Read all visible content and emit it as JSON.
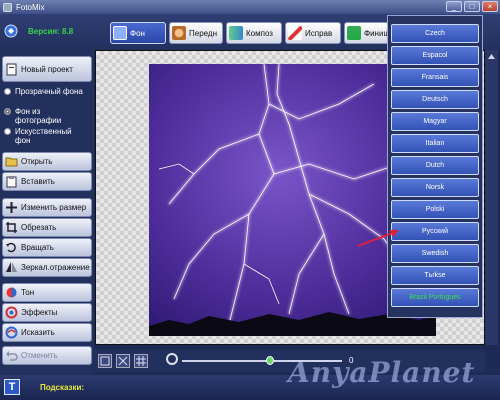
{
  "window": {
    "title": "FotoMix"
  },
  "header": {
    "version": "Версия: 8.8"
  },
  "tabs": [
    {
      "label": "Фон"
    },
    {
      "label": "Передн"
    },
    {
      "label": "Композ"
    },
    {
      "label": "Исправ"
    },
    {
      "label": "Финиш"
    }
  ],
  "sidebar": {
    "new_project": "Новый проект",
    "background_options": [
      {
        "label": "Прозрачный фона"
      },
      {
        "label": "Фон из фотографии"
      },
      {
        "label": "Искусственный фон"
      }
    ],
    "file_actions": [
      {
        "label": "Открыть"
      },
      {
        "label": "Вставить"
      }
    ],
    "edit_actions": [
      {
        "label": "Изменить размер"
      },
      {
        "label": "Обрезать"
      },
      {
        "label": "Вращать"
      },
      {
        "label": "Зеркал.отражение"
      }
    ],
    "effect_actions": [
      {
        "label": "Тон"
      },
      {
        "label": "Эффекты"
      },
      {
        "label": "Исказить"
      }
    ],
    "undo": "Отменить"
  },
  "languages": [
    "Czech",
    "Espacol",
    "Fransais",
    "Deutsch",
    "Magyar",
    "Italian",
    "Dutch",
    "Norsk",
    "Polski",
    "Русский",
    "Swedish",
    "Tьrkse",
    "Brazil Portugues"
  ],
  "zoom": {
    "value_label": "0",
    "slider_position": 0.55
  },
  "status": {
    "hints_label": "Подсказки:"
  },
  "watermark": "AnyaPlanet",
  "colors": {
    "accent": "#3253b6",
    "version_green": "#37d34a",
    "hints_yellow": "#e8e83a"
  }
}
